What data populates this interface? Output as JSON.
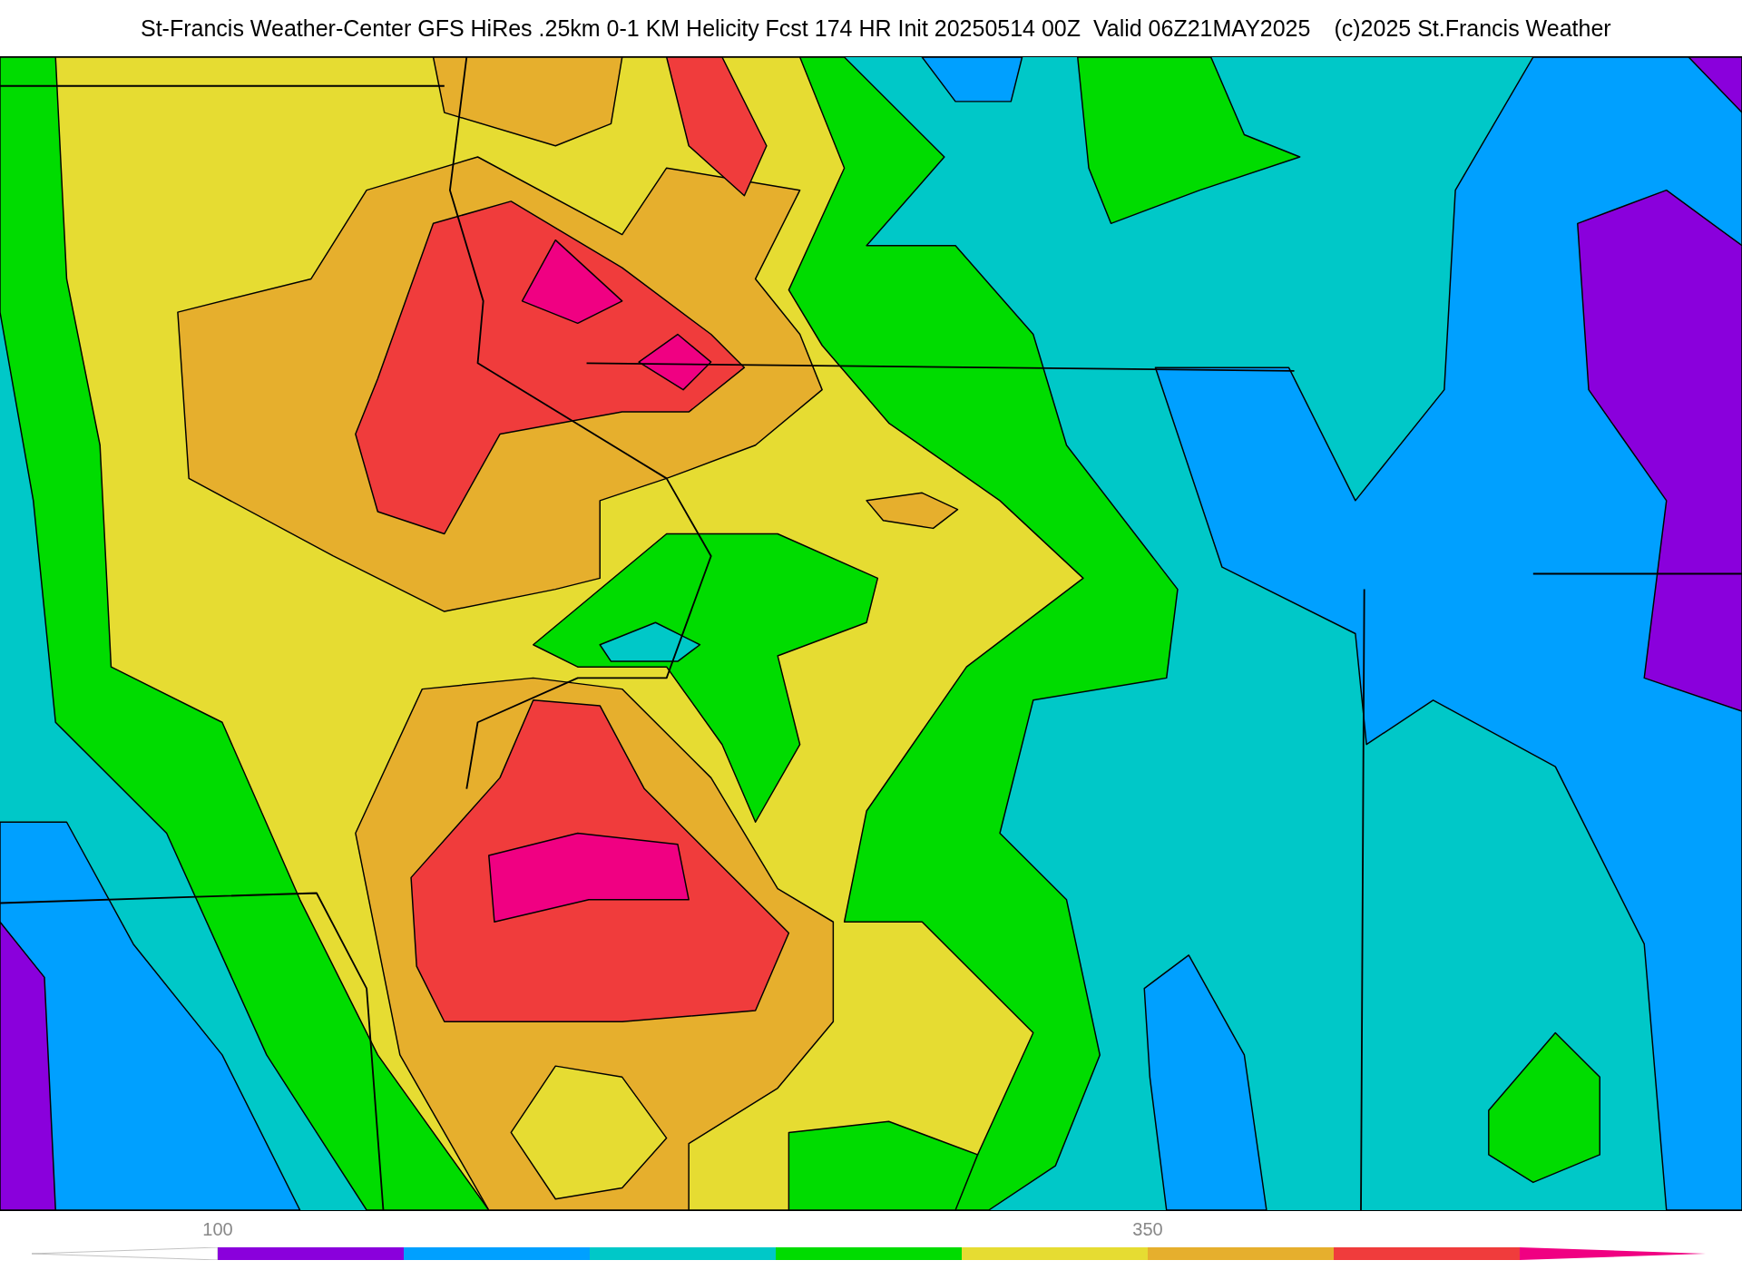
{
  "title": "St-Francis Weather-Center GFS HiRes .25km 0-1 KM Helicity Fcst 174 HR Init 20250514 00Z  Valid 06Z21MAY2025",
  "credit": "(c)2025 St.Francis Weather",
  "colorbar": {
    "segments": [
      {
        "kind": "arrow-start",
        "color": "#ffffff"
      },
      {
        "kind": "bar",
        "color": "#8a00dc",
        "label": "100"
      },
      {
        "kind": "bar",
        "color": "#00a0ff"
      },
      {
        "kind": "bar",
        "color": "#00c8c8"
      },
      {
        "kind": "bar",
        "color": "#00dc00"
      },
      {
        "kind": "bar",
        "color": "#e6dc32"
      },
      {
        "kind": "bar",
        "color": "#e6af2d",
        "label": "350"
      },
      {
        "kind": "bar",
        "color": "#f03c3c"
      },
      {
        "kind": "arrow-end",
        "color": "#f00082"
      }
    ]
  }
}
